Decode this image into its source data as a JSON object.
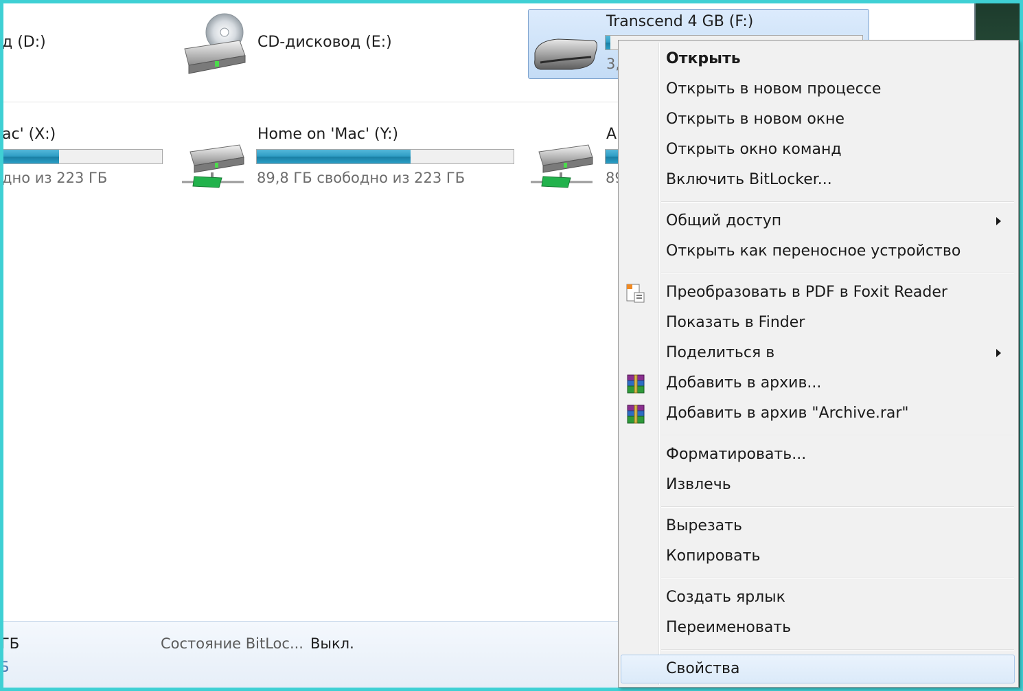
{
  "drives_top": [
    {
      "name": "д (D:)"
    },
    {
      "name": "CD-дисковод (E:)"
    },
    {
      "name": "Transcend 4 GB (F:)",
      "sub": "3,7",
      "selected": true
    }
  ],
  "drives_network": [
    {
      "name": "ac' (X:)",
      "sub": "дно из 223 ГБ",
      "used": 0.22
    },
    {
      "name": "Home on 'Mac' (Y:)",
      "sub": "89,8 ГБ свободно из 223 ГБ",
      "used": 0.6
    },
    {
      "name": "Al",
      "sub": "89"
    }
  ],
  "details": {
    "left_text": "ГБ",
    "left_text2": "Б",
    "bitlocker_label": "Состояние BitLoc...",
    "bitlocker_value": "Выкл."
  },
  "menu": {
    "items": [
      {
        "label": "Открыть",
        "bold": true
      },
      {
        "label": "Открыть в новом процессе"
      },
      {
        "label": "Открыть в новом окне"
      },
      {
        "label": "Открыть окно команд"
      },
      {
        "label": "Включить BitLocker..."
      },
      {
        "label": "Общий доступ",
        "submenu": true
      },
      {
        "label": "Открыть как переносное устройство"
      },
      {
        "label": "Преобразовать в PDF в Foxit Reader",
        "icon": "foxit-pdf-icon"
      },
      {
        "label": "Показать в Finder"
      },
      {
        "label": "Поделиться в",
        "submenu": true
      },
      {
        "label": "Добавить в архив...",
        "icon": "winrar-icon"
      },
      {
        "label": "Добавить в архив \"Archive.rar\"",
        "icon": "winrar-icon"
      },
      {
        "label": "Форматировать..."
      },
      {
        "label": "Извлечь"
      },
      {
        "label": "Вырезать"
      },
      {
        "label": "Копировать"
      },
      {
        "label": "Создать ярлык"
      },
      {
        "label": "Переименовать"
      },
      {
        "label": "Свойства",
        "highlighted": true
      }
    ]
  },
  "colors": {
    "frame": "#3fd0d4",
    "bar_fill": "#2d9cc4",
    "menu_bg": "#f1f1f1",
    "selection": "#c4dcf6"
  }
}
